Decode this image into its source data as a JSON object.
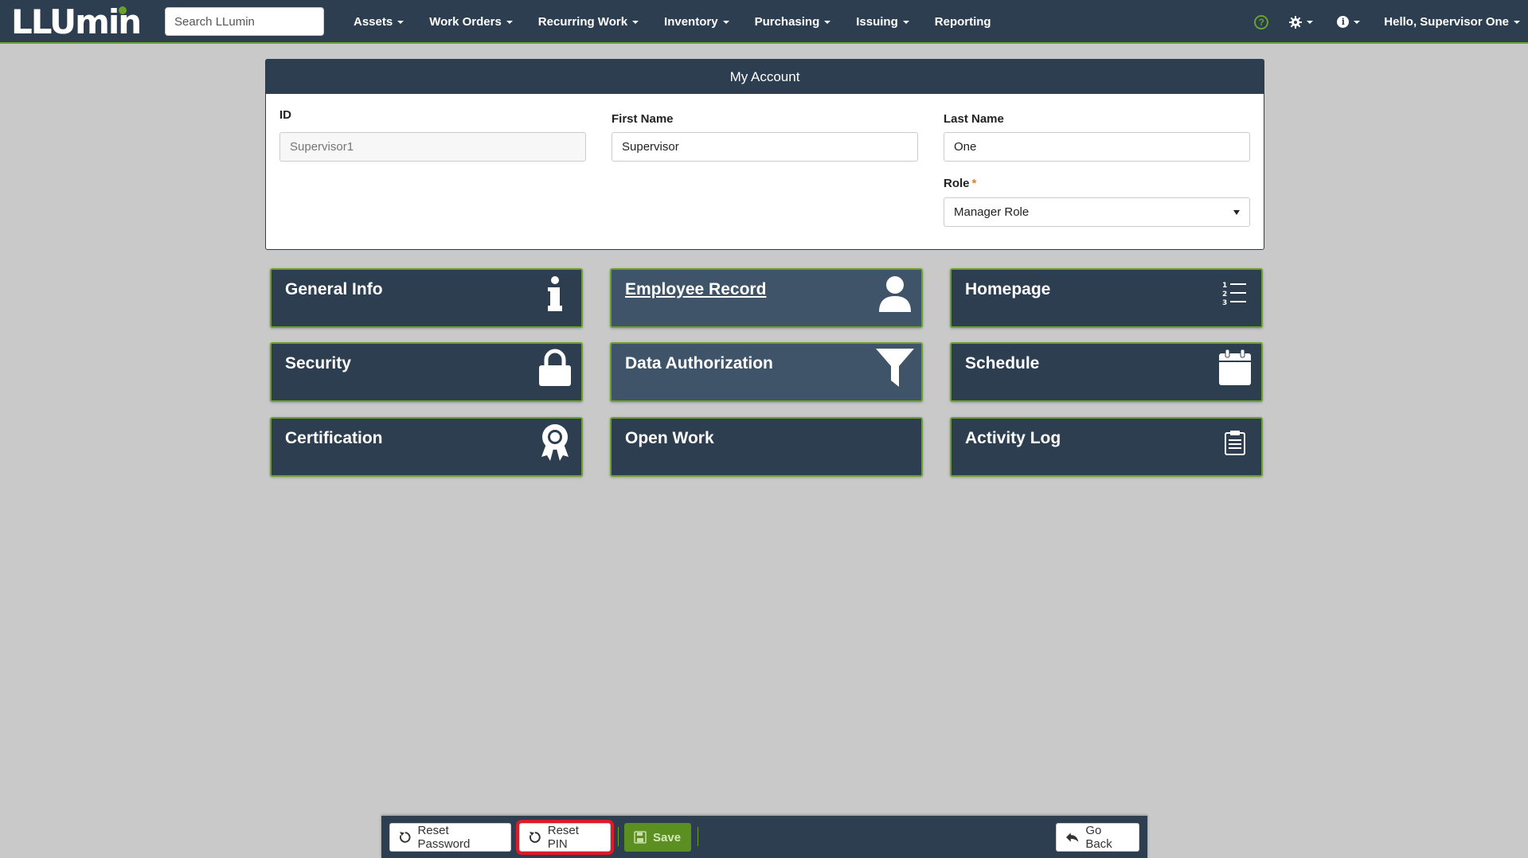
{
  "app": {
    "logo_text": "LLUmin",
    "search_placeholder": "Search LLumin"
  },
  "nav": {
    "items": [
      {
        "label": "Assets",
        "has_caret": true
      },
      {
        "label": "Work Orders",
        "has_caret": true
      },
      {
        "label": "Recurring Work",
        "has_caret": true
      },
      {
        "label": "Inventory",
        "has_caret": true
      },
      {
        "label": "Purchasing",
        "has_caret": true
      },
      {
        "label": "Issuing",
        "has_caret": true
      },
      {
        "label": "Reporting",
        "has_caret": false
      }
    ],
    "help_icon": "?",
    "settings_icon": "gear-icon",
    "info_icon": "i",
    "user_greeting": "Hello, Supervisor One"
  },
  "account": {
    "title": "My Account",
    "id_label": "ID",
    "id_placeholder": "Supervisor1",
    "first_name_label": "First Name",
    "first_name_value": "Supervisor",
    "last_name_label": "Last Name",
    "last_name_value": "One",
    "role_label": "Role",
    "role_required_mark": "*",
    "role_value": "Manager Role"
  },
  "tiles": [
    {
      "label": "General Info",
      "icon": "info-icon"
    },
    {
      "label": "Employee Record",
      "icon": "user-icon"
    },
    {
      "label": "Homepage",
      "icon": "numbered-list-icon"
    },
    {
      "label": "Security",
      "icon": "lock-icon"
    },
    {
      "label": "Data Authorization",
      "icon": "filter-icon"
    },
    {
      "label": "Schedule",
      "icon": "calendar-icon"
    },
    {
      "label": "Certification",
      "icon": "certificate-icon"
    },
    {
      "label": "Open Work",
      "icon": ""
    },
    {
      "label": "Activity Log",
      "icon": "clipboard-icon"
    }
  ],
  "toolbar": {
    "reset_password_label": "Reset Password",
    "reset_pin_label": "Reset PIN",
    "save_label": "Save",
    "go_back_label": "Go Back"
  },
  "colors": {
    "nav_bg": "#2c3e50",
    "accent_green": "#6aa12c",
    "page_bg": "#c9c9c9",
    "highlight_red": "#e01a2b"
  }
}
